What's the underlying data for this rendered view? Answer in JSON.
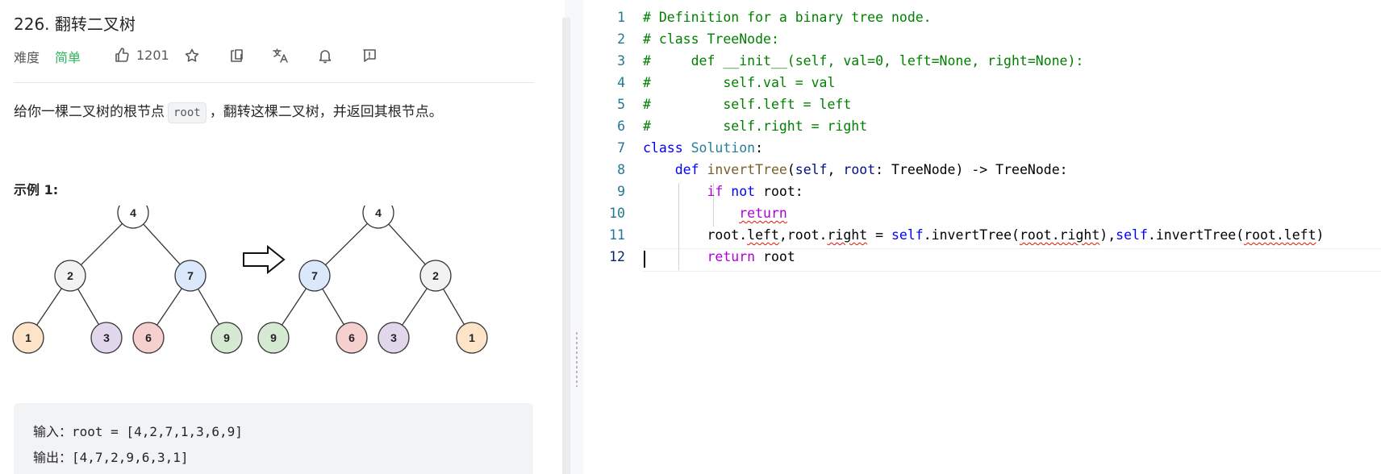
{
  "problem": {
    "title": "226. 翻转二叉树",
    "difficulty_label": "难度",
    "difficulty": "简单",
    "likes": "1201",
    "description_before": "给你一棵二叉树的根节点",
    "description_code": "root",
    "description_after": "，翻转这棵二叉树，并返回其根节点。",
    "example_title": "示例 1:",
    "example_input": "输入：root = [4,2,7,1,3,6,9]",
    "example_output": "输出：[4,7,2,9,6,3,1]",
    "tree_before": [
      "4",
      "2",
      "7",
      "1",
      "3",
      "6",
      "9"
    ],
    "tree_after": [
      "4",
      "7",
      "2",
      "9",
      "6",
      "3",
      "1"
    ],
    "node_colors": {
      "4": "#ffffff",
      "2": "#f2f2f2",
      "7": "#dbe8fb",
      "1": "#fde3c8",
      "3": "#e2d6ec",
      "6": "#f6cfcf",
      "9": "#d6ead3"
    }
  },
  "icons": [
    "like-icon",
    "star-icon",
    "share-icon",
    "translate-icon",
    "bell-icon",
    "feedback-icon",
    "arrow-right-icon"
  ],
  "editor": {
    "line_numbers": [
      "1",
      "2",
      "3",
      "4",
      "5",
      "6",
      "7",
      "8",
      "9",
      "10",
      "11",
      "12"
    ],
    "lines": [
      [
        [
          "c-com",
          "# Definition for a binary tree node."
        ]
      ],
      [
        [
          "c-com",
          "# class TreeNode:"
        ]
      ],
      [
        [
          "c-com",
          "#     def __init__(self, val=0, left=None, right=None):"
        ]
      ],
      [
        [
          "c-com",
          "#         self.val = val"
        ]
      ],
      [
        [
          "c-com",
          "#         self.left = left"
        ]
      ],
      [
        [
          "c-com",
          "#         self.right = right"
        ]
      ],
      [
        [
          "c-kw",
          "class"
        ],
        [
          "c-plain",
          " "
        ],
        [
          "c-cls",
          "Solution"
        ],
        [
          "c-plain",
          ":"
        ]
      ],
      [
        [
          "c-plain",
          "    "
        ],
        [
          "c-kw",
          "def"
        ],
        [
          "c-plain",
          " "
        ],
        [
          "c-fn",
          "invertTree"
        ],
        [
          "c-plain",
          "("
        ],
        [
          "c-var",
          "self"
        ],
        [
          "c-plain",
          ", "
        ],
        [
          "c-var",
          "root"
        ],
        [
          "c-plain",
          ": TreeNode) -> TreeNode:"
        ]
      ],
      [
        [
          "c-plain",
          "        "
        ],
        [
          "c-ctl",
          "if"
        ],
        [
          "c-plain",
          " "
        ],
        [
          "c-kw",
          "not"
        ],
        [
          "c-plain",
          " root:"
        ]
      ],
      [
        [
          "c-plain",
          "            "
        ],
        [
          "c-ctl squig",
          "return"
        ]
      ],
      [
        [
          "c-plain",
          "        root."
        ],
        [
          "c-plain squig",
          "left"
        ],
        [
          "c-plain",
          ",root."
        ],
        [
          "c-plain squig",
          "right"
        ],
        [
          "c-plain",
          " = "
        ],
        [
          "c-kw",
          "self"
        ],
        [
          "c-plain",
          ".invertTree("
        ],
        [
          "c-plain squig",
          "root.right"
        ],
        [
          "c-plain",
          "),"
        ],
        [
          "c-kw",
          "self"
        ],
        [
          "c-plain",
          ".invertTree("
        ],
        [
          "c-plain squig",
          "root.left"
        ],
        [
          "c-plain",
          ")"
        ]
      ],
      [
        [
          "c-plain",
          "        "
        ],
        [
          "c-ctl",
          "return"
        ],
        [
          "c-plain",
          " root"
        ]
      ]
    ]
  }
}
